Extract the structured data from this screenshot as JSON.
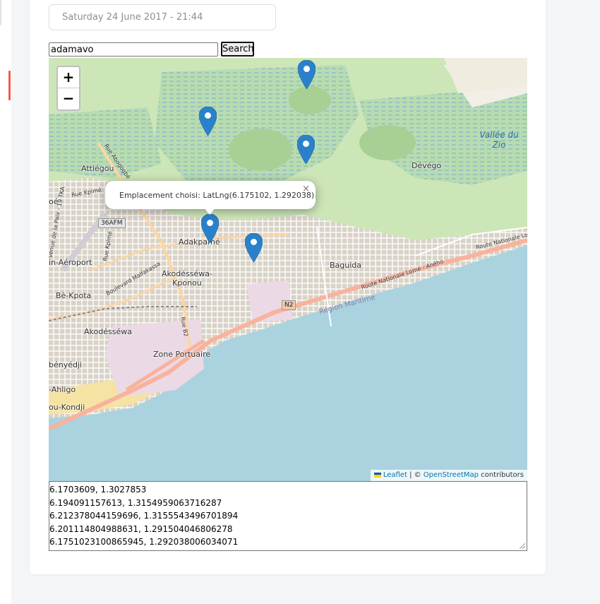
{
  "date_display": "Saturday 24 June 2017 - 21:44",
  "search": {
    "value": "adamavo",
    "button_label": "Search"
  },
  "map": {
    "zoom_in": "+",
    "zoom_out": "−",
    "popup": {
      "text": "Emplacement choisi: LatLng(6.175102, 1.292038)",
      "close": "×"
    },
    "attribution": {
      "leaflet": "Leaflet",
      "separator": " | © ",
      "osm": "OpenStreetMap",
      "suffix": " contributors"
    },
    "places": {
      "attiegou": "Attiégou",
      "devego": "Dévégo",
      "vallee1": "Vallée du",
      "vallee2": "Zio",
      "adakpame": "Adakpamé",
      "baguida": "Baguida",
      "akodessewa_kponou1": "Akodésséwa-",
      "akodessewa_kponou2": "Kponou",
      "aeroport": "in-Aéroport",
      "be_kpota": "Bè-Kpota",
      "akodessewa": "Akodésséwa",
      "zone_portuaire": "Zone Portuaire",
      "benyedji": "bényédji",
      "ahligo": "-Ahligo",
      "kondji": "ou-Kondji",
      "oe": "oé",
      "region_maritime": "Région Maritime"
    },
    "roads": {
      "rue_abogogbe": "Rue Abogogbé",
      "rue_kpime1": "Rue Kpimé",
      "rue_kpime2": "Rue Kpimé",
      "avenue_paix": "venue de la Paix - 19 TKA",
      "blvd_malfakassa": "Boulevard Malfakassa",
      "rue_b2": "Rue B2",
      "rn_lome_aneho": "Route Nationale Lomé - Aného",
      "rn_lome": "Route Nationale Lom"
    },
    "shields": {
      "s36afm": "36AFM",
      "n2": "N2"
    },
    "colors": {
      "sea": "#aad3df",
      "forest": "#add19e",
      "urban": "#e0dcd4",
      "road_primary": "#fcd6a4",
      "road_trunk": "#f9b29c",
      "marker": "#2a81cb",
      "popup_bg": "#ffffff"
    }
  },
  "coordinates": [
    "6.1703609, 1.3027853",
    "6.194091157613, 1.3154959063716287",
    "6.212378044159696, 1.3155543496701894",
    "6.201114804988631, 1.291504046806278",
    "6.1751023100865945, 1.292038006034071"
  ]
}
